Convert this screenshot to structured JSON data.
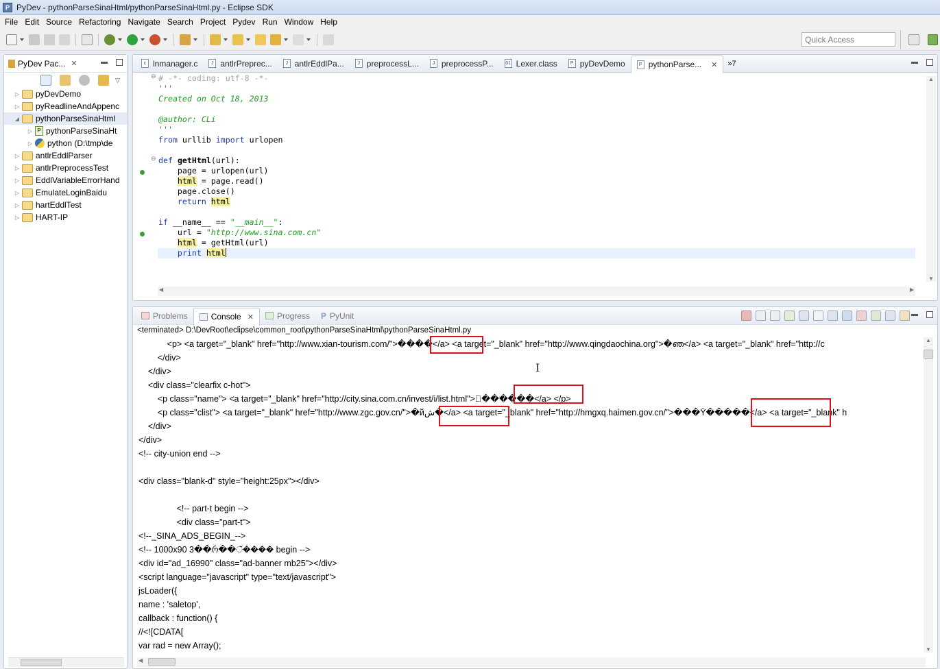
{
  "window": {
    "title": "PyDev - pythonParseSinaHtml/pythonParseSinaHtml.py - Eclipse SDK"
  },
  "menu": [
    "File",
    "Edit",
    "Source",
    "Refactoring",
    "Navigate",
    "Search",
    "Project",
    "Pydev",
    "Run",
    "Window",
    "Help"
  ],
  "quick_access": {
    "placeholder": "Quick Access"
  },
  "explorer": {
    "title": "PyDev Pac...",
    "items": [
      {
        "label": "pyDevDemo",
        "indent": 0
      },
      {
        "label": "pyReadlineAndAppenc",
        "indent": 0
      },
      {
        "label": "pythonParseSinaHtml",
        "indent": 0
      },
      {
        "label": "pythonParseSinaHt",
        "indent": 1
      },
      {
        "label": "python  (D:\\tmp\\de",
        "indent": 1
      },
      {
        "label": "antlrEddlParser",
        "indent": 0
      },
      {
        "label": "antlrPreprocessTest",
        "indent": 0
      },
      {
        "label": "EddlVariableErrorHand",
        "indent": 0
      },
      {
        "label": "EmulateLoginBaidu",
        "indent": 0
      },
      {
        "label": "hartEddlTest",
        "indent": 0
      },
      {
        "label": "HART-IP",
        "indent": 0
      }
    ]
  },
  "editor_tabs": [
    "lnmanager.c",
    "antlrPreprec...",
    "antlrEddlPa...",
    "preprocessL...",
    "preprocessP...",
    "Lexer.class",
    "pyDevDemo",
    "pythonParse..."
  ],
  "editor_tab_overflow": "»7",
  "code": {
    "l1": "# -*- coding: utf-8 -*-",
    "l2": "'''",
    "l3": "Created on Oct 18, 2013",
    "l5": "@author: CLi",
    "l6": "'''",
    "l7a": "from",
    "l7b": " urllib ",
    "l7c": "import",
    "l7d": " urlopen",
    "l9a": "def",
    "l9b": "getHtml",
    "l9c": "(url):",
    "l10": "    page = urlopen(url)",
    "l11a": "html",
    "l11b": " = page.read()",
    "l12": "    page.close()",
    "l13a": "return",
    "l13b": "html",
    "l15a": "if",
    "l15b": " __name__ == ",
    "l15c": "\"__main__\"",
    "l15d": ":",
    "l16a": "    url = ",
    "l16b": "\"http://www.sina.com.cn\"",
    "l17a": "html",
    "l17b": " = getHtml(url)",
    "l18a": "print",
    "l18b": "html"
  },
  "console_tabs": {
    "problems": "Problems",
    "console": "Console",
    "progress": "Progress",
    "pyunit": "PyUnit"
  },
  "console": {
    "terminated": "<terminated> D:\\DevRoot\\eclipse\\common_root\\pythonParseSinaHtml\\pythonParseSinaHtml.py",
    "lines": [
      "            <p> <a target=\"_blank\" href=\"http://www.xian-tourism.com/\">����</a> <a target=\"_blank\" href=\"http://www.qingdaochina.org\">�ഞ</a> <a target=\"_blank\" href=\"http://c",
      "        </div>",
      "    </div>",
      "    <div class=\"clearfix c-hot\">",
      "        <p class=\"name\"> <a target=\"_blank\" href=\"http://city.sina.com.cn/invest/i/list.html\">\u0000������</a> </p>",
      "        <p class=\"clist\"> <a target=\"_blank\" href=\"http://www.zgc.gov.cn/\">�йش�</a> <a target=\"_blank\" href=\"http://hmgxq.haimen.gov.cn/\">���Ÿ�����</a> <a target=\"_blank\" h",
      "    </div>",
      "</div>",
      "<!-- city-union end -->",
      "",
      "<div class=\"blank-d\" style=\"height:25px\"></div>",
      "",
      "                <!-- part-t begin -->",
      "                <div class=\"part-t\">",
      "<!--_SINA_ADS_BEGIN_-->",
      "<!-- 1000x90 3��რ��ੱ���� begin -->",
      "<div id=\"ad_16990\" class=\"ad-banner mb25\"></div>",
      "<script language=\"javascript\" type=\"text/javascript\">",
      "jsLoader({",
      "name : 'saletop',",
      "callback : function() {",
      "//<![CDATA[",
      "var rad = new Array();"
    ]
  },
  "colors": {
    "highlight_box": "#e0101a",
    "string": "#1c9c1c",
    "keyword": "#1e3ca6",
    "comment": "#a3a3a3"
  }
}
